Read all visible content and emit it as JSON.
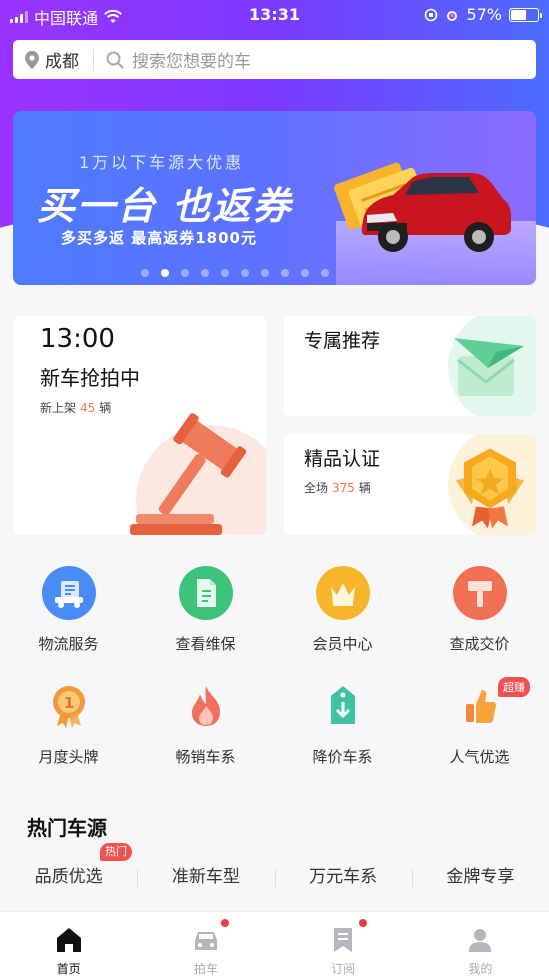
{
  "status_bar": {
    "carrier": "中国联通",
    "time": "13:31",
    "battery": "57%"
  },
  "search": {
    "city": "成都",
    "placeholder": "搜索您想要的车"
  },
  "banner": {
    "subtitle": "1万以下车源大优惠",
    "title": "买一台 也返券",
    "description": "多买多返  最高返券1800元",
    "dot_count": 10,
    "active_dot": 1
  },
  "auction_card": {
    "time": "13:00",
    "title": "新车抢拍中",
    "count_prefix": "新上架",
    "count": "45",
    "count_suffix": "辆"
  },
  "recommend_card": {
    "title": "专属推荐"
  },
  "certified_card": {
    "title": "精品认证",
    "count_prefix": "全场",
    "count": "375",
    "count_suffix": "辆"
  },
  "services": [
    {
      "label": "物流服务",
      "icon": "truck-icon",
      "color": "#4a8cf5"
    },
    {
      "label": "查看维保",
      "icon": "document-icon",
      "color": "#3dc37a"
    },
    {
      "label": "会员中心",
      "icon": "crown-icon",
      "color": "#f6b52a"
    },
    {
      "label": "查成交价",
      "icon": "hammer-icon",
      "color": "#f07054"
    },
    {
      "label": "月度头牌",
      "icon": "medal-icon",
      "color": "#f39a3a"
    },
    {
      "label": "畅销车系",
      "icon": "flame-icon",
      "color": "#f0705e"
    },
    {
      "label": "降价车系",
      "icon": "price-down-tag-icon",
      "color": "#3dc3a2"
    },
    {
      "label": "人气优选",
      "icon": "thumbs-up-icon",
      "color": "#f5a33a",
      "tag": "超赚"
    }
  ],
  "hot_section": {
    "title": "热门车源",
    "tabs": [
      "品质优选",
      "准新车型",
      "万元车系",
      "金牌专享"
    ],
    "first_tab_badge": "热门"
  },
  "tab_bar": [
    {
      "label": "首页",
      "icon": "home-icon",
      "active": true
    },
    {
      "label": "拍车",
      "icon": "car-icon",
      "dot": true
    },
    {
      "label": "订阅",
      "icon": "bookmark-icon",
      "dot": true
    },
    {
      "label": "我的",
      "icon": "user-icon"
    }
  ],
  "colors": {
    "header_gradient_start": "#9a33ff",
    "header_gradient_end": "#4b6cff",
    "accent_orange": "#f07843",
    "badge_red": "#ef5350"
  }
}
